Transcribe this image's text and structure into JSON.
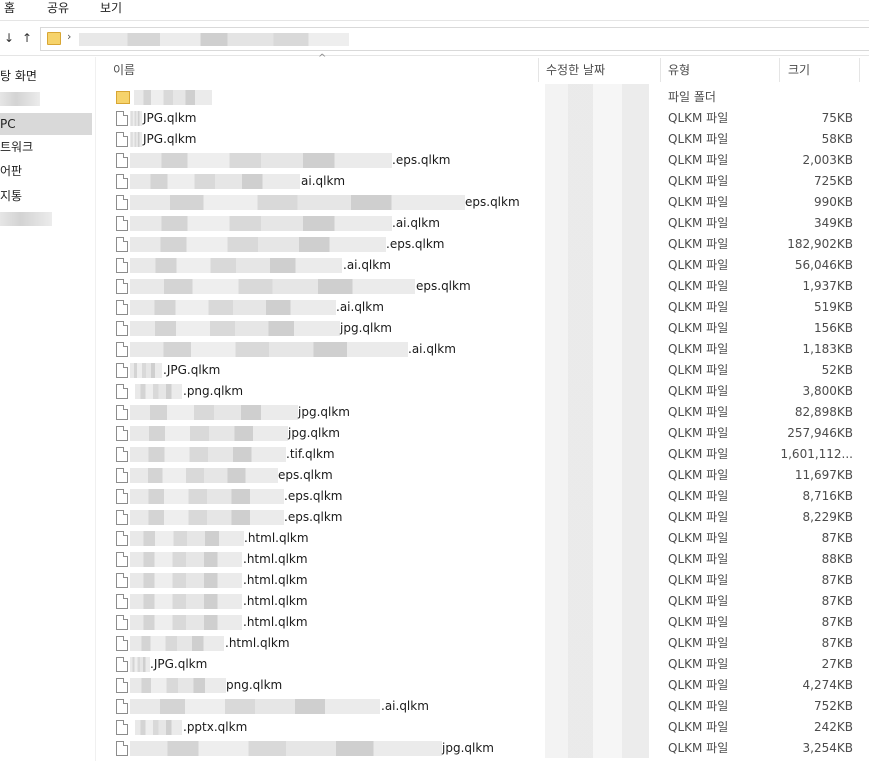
{
  "ribbon": {
    "tabs": [
      "홈",
      "공유",
      "보기"
    ]
  },
  "address": {
    "back": "↓",
    "up": "↑",
    "chevron": "›"
  },
  "nav": {
    "items": [
      {
        "label": "탕 화면",
        "blurred": false,
        "selected": false
      },
      {
        "label": "",
        "blurred": true,
        "selected": false
      },
      {
        "label": " PC",
        "blurred": false,
        "selected": true
      },
      {
        "label": "트워크",
        "blurred": false,
        "selected": false
      },
      {
        "label": "어판",
        "blurred": false,
        "selected": false
      },
      {
        "label": "지통",
        "blurred": false,
        "selected": false
      },
      {
        "label": "",
        "blurred": true,
        "selected": false
      }
    ]
  },
  "columns": {
    "name": "이름",
    "date": "수정한 날짜",
    "type": "유형",
    "size": "크기",
    "sort_arrow": "^"
  },
  "files": [
    {
      "name": "",
      "type": "파일 폴더",
      "size": "",
      "folder": true
    },
    {
      "name": "JPG.qlkm",
      "type": "QLKM 파일",
      "size": "75KB"
    },
    {
      "name": "JPG.qlkm",
      "type": "QLKM 파일",
      "size": "58KB"
    },
    {
      "name": ".eps.qlkm",
      "type": "QLKM 파일",
      "size": "2,003KB"
    },
    {
      "name": "ai.qlkm",
      "type": "QLKM 파일",
      "size": "725KB"
    },
    {
      "name": "eps.qlkm",
      "type": "QLKM 파일",
      "size": "990KB"
    },
    {
      "name": ".ai.qlkm",
      "type": "QLKM 파일",
      "size": "349KB"
    },
    {
      "name": ".eps.qlkm",
      "type": "QLKM 파일",
      "size": "182,902KB"
    },
    {
      "name": ".ai.qlkm",
      "type": "QLKM 파일",
      "size": "56,046KB"
    },
    {
      "name": "eps.qlkm",
      "type": "QLKM 파일",
      "size": "1,937KB"
    },
    {
      "name": ".ai.qlkm",
      "type": "QLKM 파일",
      "size": "519KB"
    },
    {
      "name": "jpg.qlkm",
      "type": "QLKM 파일",
      "size": "156KB"
    },
    {
      "name": ".ai.qlkm",
      "type": "QLKM 파일",
      "size": "1,183KB"
    },
    {
      "name": ".JPG.qlkm",
      "type": "QLKM 파일",
      "size": "52KB"
    },
    {
      "name": ".png.qlkm",
      "type": "QLKM 파일",
      "size": "3,800KB"
    },
    {
      "name": "jpg.qlkm",
      "type": "QLKM 파일",
      "size": "82,898KB"
    },
    {
      "name": "jpg.qlkm",
      "type": "QLKM 파일",
      "size": "257,946KB"
    },
    {
      "name": ".tif.qlkm",
      "type": "QLKM 파일",
      "size": "1,601,112..."
    },
    {
      "name": "eps.qlkm",
      "type": "QLKM 파일",
      "size": "11,697KB"
    },
    {
      "name": ".eps.qlkm",
      "type": "QLKM 파일",
      "size": "8,716KB"
    },
    {
      "name": ".eps.qlkm",
      "type": "QLKM 파일",
      "size": "8,229KB"
    },
    {
      "name": ".html.qlkm",
      "type": "QLKM 파일",
      "size": "87KB"
    },
    {
      "name": ".html.qlkm",
      "type": "QLKM 파일",
      "size": "88KB"
    },
    {
      "name": ".html.qlkm",
      "type": "QLKM 파일",
      "size": "87KB"
    },
    {
      "name": ".html.qlkm",
      "type": "QLKM 파일",
      "size": "87KB"
    },
    {
      "name": ".html.qlkm",
      "type": "QLKM 파일",
      "size": "87KB"
    },
    {
      "name": ".html.qlkm",
      "type": "QLKM 파일",
      "size": "87KB"
    },
    {
      "name": ".JPG.qlkm",
      "type": "QLKM 파일",
      "size": "27KB"
    },
    {
      "name": "png.qlkm",
      "type": "QLKM 파일",
      "size": "4,274KB"
    },
    {
      "name": ".ai.qlkm",
      "type": "QLKM 파일",
      "size": "752KB"
    },
    {
      "name": ".pptx.qlkm",
      "type": "QLKM 파일",
      "size": "242KB"
    },
    {
      "name": "jpg.qlkm",
      "type": "QLKM 파일",
      "size": "3,254KB"
    }
  ]
}
